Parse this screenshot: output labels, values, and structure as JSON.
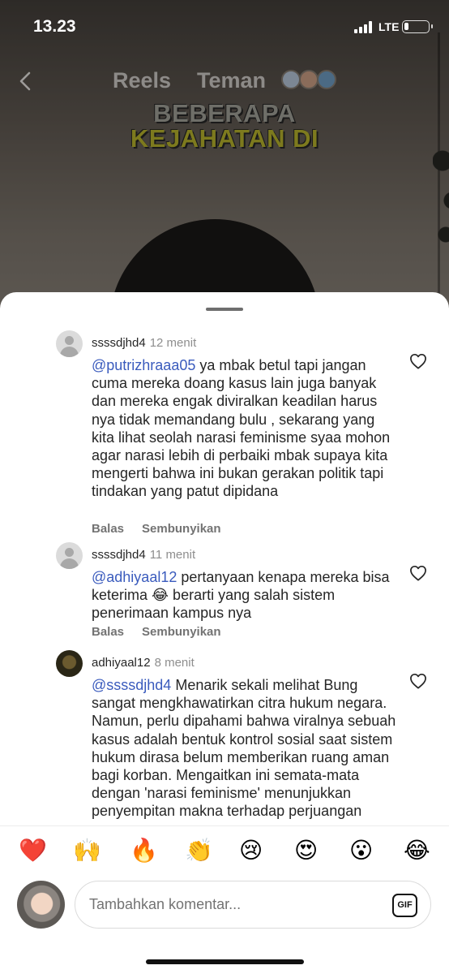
{
  "status_bar": {
    "time": "13.23",
    "network": "LTE",
    "battery_percent": 10
  },
  "header": {
    "tabs": [
      "Reels",
      "Teman"
    ]
  },
  "video": {
    "overlay_line1": "BEBERAPA",
    "overlay_line2": "KEJAHATAN DI"
  },
  "comments": [
    {
      "username": "ssssdjhd4",
      "time": "12 menit",
      "mention": "@putrizhraaa05",
      "text": " ya mbak betul tapi jangan cuma mereka doang kasus lain juga banyak dan mereka engak diviralkan keadilan harus nya tidak memandang bulu , sekarang yang kita lihat seolah narasi feminisme syaa mohon agar narasi lebih di perbaiki mbak supaya kita mengerti bahwa ini bukan gerakan politik tapi tindakan yang patut dipidana",
      "reply": "Balas",
      "hide": "Sembunyikan"
    },
    {
      "username": "ssssdjhd4",
      "time": "11 menit",
      "mention": "@adhiyaal12",
      "text": " pertanyaan kenapa mereka bisa keterima 😂 berarti yang salah sistem penerimaan kampus nya",
      "reply": "Balas",
      "hide": "Sembunyikan"
    },
    {
      "username": "adhiyaal12",
      "time": "8 menit",
      "mention": "@ssssdjhd4",
      "text": " Menarik sekali melihat Bung sangat mengkhawatirkan citra hukum negara. Namun, perlu dipahami bahwa viralnya sebuah kasus adalah bentuk kontrol sosial saat sistem hukum dirasa belum memberikan ruang aman bagi korban. Mengaitkan ini semata-mata dengan 'narasi feminisme' menunjukkan penyempitan makna terhadap perjuangan"
    }
  ],
  "emoji_bar": [
    "❤️",
    "🙌",
    "🔥",
    "👏",
    "😢",
    "😍",
    "😮",
    "😂"
  ],
  "composer": {
    "placeholder": "Tambahkan komentar...",
    "gif_label": "GIF"
  },
  "colors": {
    "mention": "#3a5bbd",
    "muted": "#8e8e8e",
    "text": "#262626"
  }
}
